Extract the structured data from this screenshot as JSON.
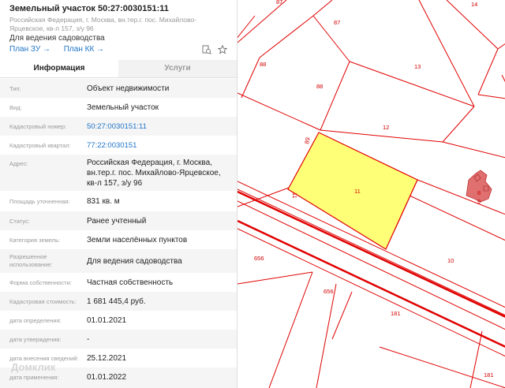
{
  "header": {
    "title": "Земельный участок 50:27:0030151:11",
    "address": "Российская Федерация, г. Москва, вн.тер.г. пос. Михайлово-Ярцевское, кв-л 157, з/у 96",
    "usage": "Для ведения садоводства",
    "plan_zu": "План ЗУ →",
    "plan_kk": "План КК →",
    "icons": [
      "search-document-icon",
      "star-icon"
    ]
  },
  "tabs": {
    "info": "Информация",
    "services": "Услуги"
  },
  "info": [
    {
      "label": "Тип:",
      "value": "Объект недвижимости"
    },
    {
      "label": "Вид:",
      "value": "Земельный участок"
    },
    {
      "label": "Кадастровый номер:",
      "value": "50:27:0030151:11"
    },
    {
      "label": "Кадастровый квартал:",
      "value": "77:22:0030151"
    },
    {
      "label": "Адрес:",
      "value": "Российская Федерация, г. Москва, вн.тер.г. пос. Михайлово-Ярцевское, кв-л 157, з/у 96"
    },
    {
      "label": "Площадь уточненная:",
      "value": "831 кв. м"
    },
    {
      "label": "Статус:",
      "value": "Ранее учтенный"
    },
    {
      "label": "Категория земель:",
      "value": "Земли населённых пунктов"
    },
    {
      "label": "Разрешенное использование:",
      "value": "Для ведения садоводства"
    },
    {
      "label": "Форма собственности:",
      "value": "Частная собственность"
    },
    {
      "label": "Кадастровая стоимость:",
      "value": "1 681 445,4 руб."
    },
    {
      "label": "дата определения:",
      "value": "01.01.2021"
    },
    {
      "label": "дата утверждения:",
      "value": "-"
    },
    {
      "label": "дата внесения сведений:",
      "value": "25.12.2021"
    },
    {
      "label": "дата применения:",
      "value": "01.01.2022"
    }
  ],
  "watermark": "Домклик",
  "map": {
    "parcel_labels": [
      "87",
      "14",
      "87",
      "88",
      "13",
      "88",
      "12",
      "89",
      "11",
      "11",
      "8",
      "9",
      "656",
      "10",
      "656",
      "181",
      "181"
    ],
    "highlight_color": "#ffff77",
    "line_color": "#e00000",
    "building_color": "#e07070"
  }
}
